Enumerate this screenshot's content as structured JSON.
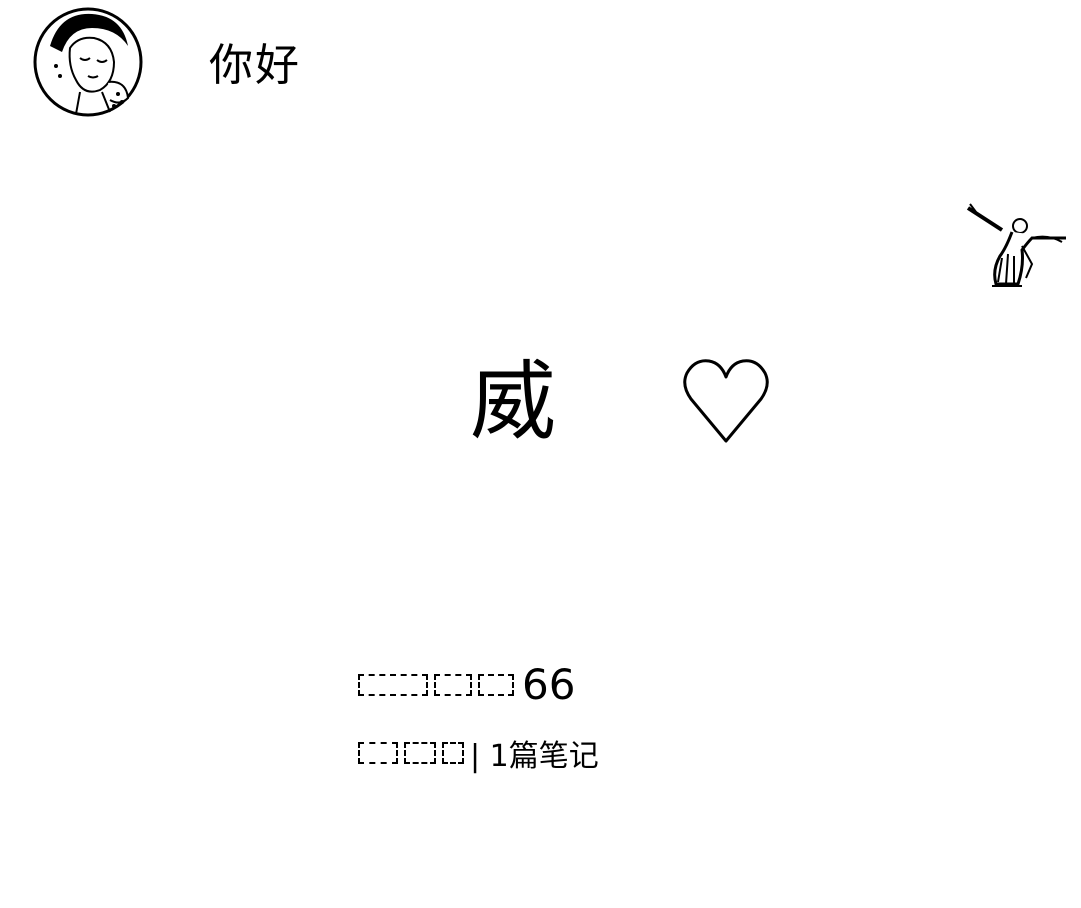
{
  "header": {
    "greeting": "你好",
    "avatar_icon": "illustrated-woman-avatar-icon"
  },
  "decoration": {
    "figure_icon": "dancing-figure-illustration-icon"
  },
  "main": {
    "title_char": "威",
    "heart_icon": "heart-outline-icon"
  },
  "profile": {
    "username_visible_suffix": "66",
    "notes_count_text": "| 1篇笔记"
  }
}
